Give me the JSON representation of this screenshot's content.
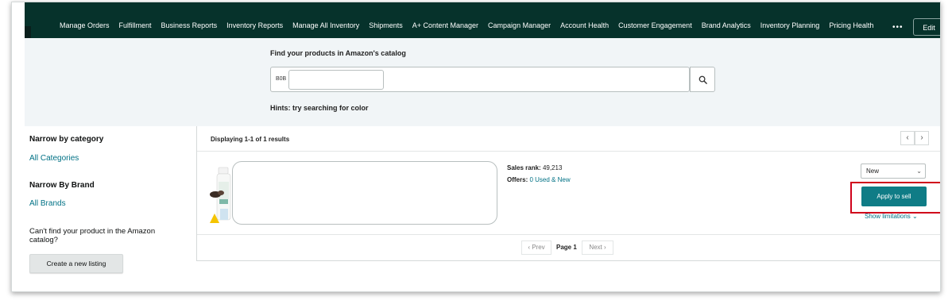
{
  "nav": {
    "items": [
      "Manage Orders",
      "Fulfillment",
      "Business Reports",
      "Inventory Reports",
      "Manage All Inventory",
      "Shipments",
      "A+ Content Manager",
      "Campaign Manager",
      "Account Health",
      "Customer Engagement",
      "Brand Analytics",
      "Inventory Planning",
      "Pricing Health"
    ],
    "more_label": "•••",
    "edit_label": "Edit"
  },
  "search": {
    "heading": "Find your products in Amazon's catalog",
    "prefix": "B0B",
    "value": "",
    "hint": "Hints: try searching for color"
  },
  "sidebar": {
    "category_heading": "Narrow by category",
    "category_link": "All Categories",
    "brand_heading": "Narrow By Brand",
    "brand_link": "All Brands",
    "cant_find": "Can't find your product in the Amazon catalog?",
    "create_button": "Create a new listing"
  },
  "results": {
    "count_text": "Displaying 1-1 of 1 results",
    "item": {
      "sales_rank_label": "Sales rank:",
      "sales_rank_value": "49,213",
      "offers_label": "Offers:",
      "offers_value": "0 Used & New",
      "condition": "New",
      "apply_button": "Apply to sell",
      "limitations_link": "Show limitations"
    },
    "pagination": {
      "prev": "Prev",
      "current": "Page 1",
      "next": "Next"
    }
  },
  "colors": {
    "nav_bg": "#06322b",
    "band_bg": "#f1f5f7",
    "link": "#007185",
    "primary_button": "#0f7c86",
    "highlight": "#d0021b"
  }
}
